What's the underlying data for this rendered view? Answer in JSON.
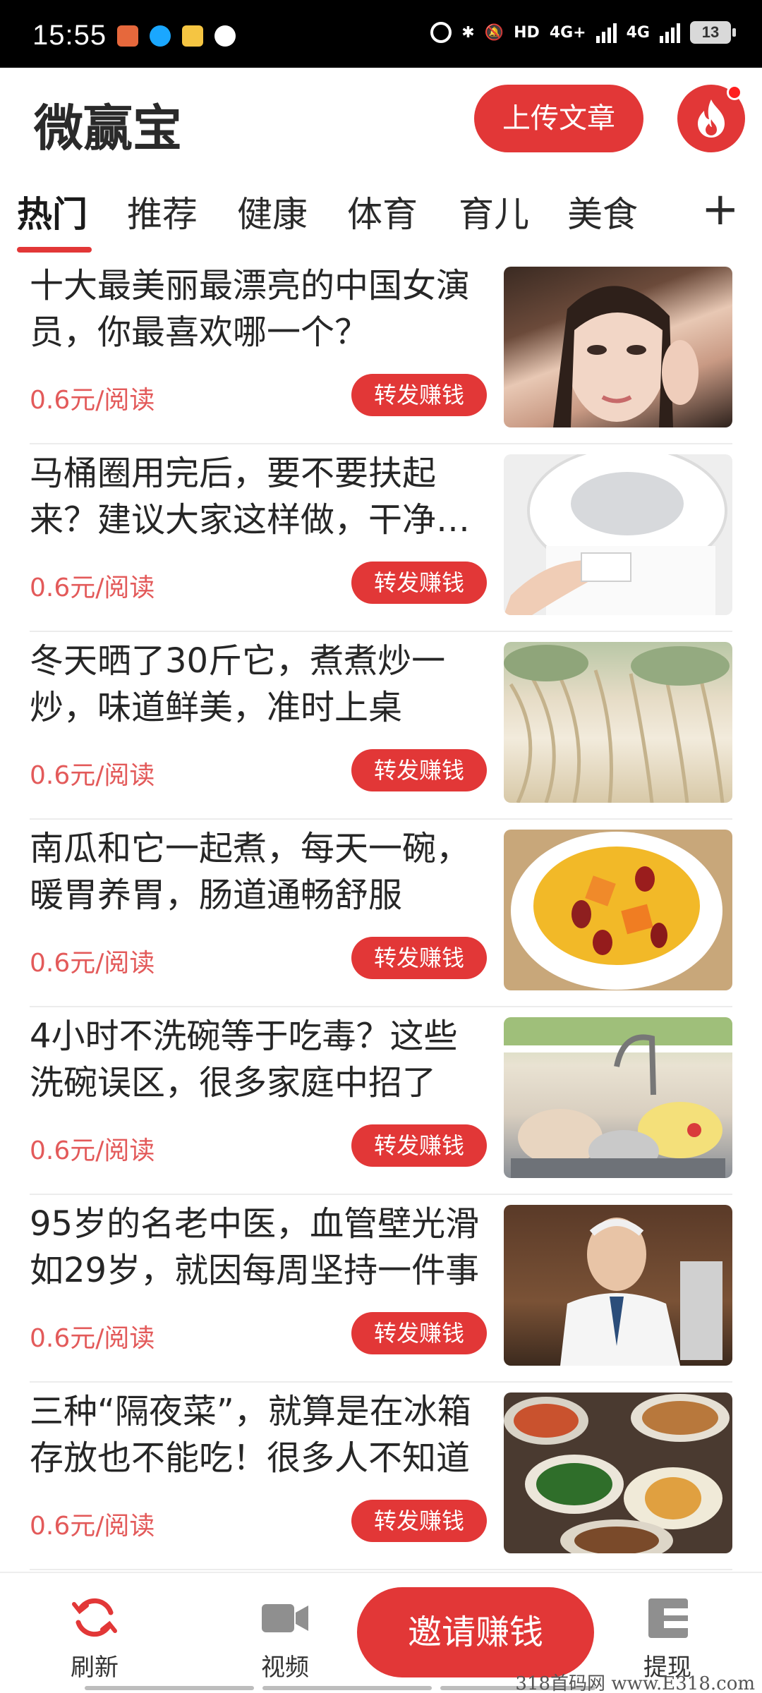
{
  "status_bar": {
    "time": "15:55",
    "network_1": "4G+",
    "network_2": "4G",
    "hd_label": "HD",
    "battery": "13"
  },
  "header": {
    "app_title": "微赢宝",
    "upload_label": "上传文章",
    "accent_color": "#e23737"
  },
  "tabs": [
    {
      "label": "热门",
      "active": true
    },
    {
      "label": "推荐"
    },
    {
      "label": "健康"
    },
    {
      "label": "体育"
    },
    {
      "label": "育儿"
    },
    {
      "label": "美食"
    }
  ],
  "tab_add": "+",
  "articles": [
    {
      "title": "十大最美丽最漂亮的中国女演员，你最喜欢哪一个？",
      "price": "0.6元/阅读",
      "share": "转发赚钱",
      "thumb": "portrait-photo"
    },
    {
      "title": "马桶圈用完后，要不要扶起来？建议大家这样做，干净又卫生",
      "price": "0.6元/阅读",
      "share": "转发赚钱",
      "thumb": "toilet-photo"
    },
    {
      "title": "冬天晒了30斤它，煮煮炒一炒，味道鲜美，准时上桌",
      "price": "0.6元/阅读",
      "share": "转发赚钱",
      "thumb": "dried-vegetable-photo"
    },
    {
      "title": "南瓜和它一起煮，每天一碗，暖胃养胃，肠道通畅舒服",
      "price": "0.6元/阅读",
      "share": "转发赚钱",
      "thumb": "pumpkin-porridge-photo"
    },
    {
      "title": "4小时不洗碗等于吃毒？这些洗碗误区，很多家庭中招了",
      "price": "0.6元/阅读",
      "share": "转发赚钱",
      "thumb": "dirty-dishes-photo"
    },
    {
      "title": "95岁的名老中医，血管壁光滑如29岁，就因每周坚持一件事",
      "price": "0.6元/阅读",
      "share": "转发赚钱",
      "thumb": "doctor-photo"
    },
    {
      "title": "三种“隔夜菜”，就算是在冰箱存放也不能吃！很多人不知道",
      "price": "0.6元/阅读",
      "share": "转发赚钱",
      "thumb": "dishes-table-photo"
    }
  ],
  "bottom_nav": {
    "refresh_label": "刷新",
    "video_label": "视频",
    "invite_label": "邀请赚钱",
    "withdraw_label": "提现",
    "icons": [
      "refresh-icon",
      "video-camera-icon",
      "wallet-icon"
    ]
  },
  "watermark": "318首码网 www.E318.com"
}
